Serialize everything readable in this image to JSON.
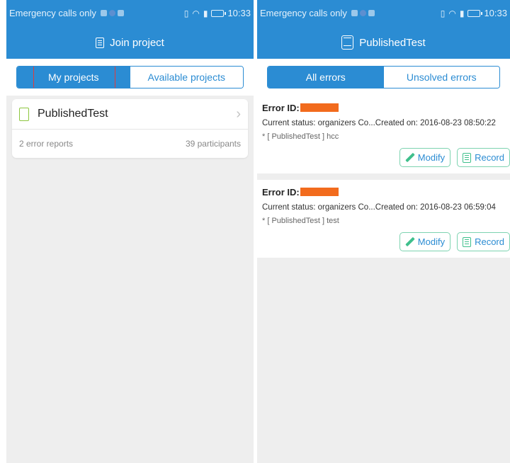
{
  "left_screen": {
    "status_bar": {
      "carrier_text": "Emergency calls only",
      "time": "10:33"
    },
    "title": "Join project",
    "tabs": [
      {
        "label": "My projects",
        "active": true
      },
      {
        "label": "Available projects",
        "active": false
      }
    ],
    "project": {
      "name": "PublishedTest",
      "error_reports": "2 error reports",
      "participants": "39 participants"
    }
  },
  "right_screen": {
    "status_bar": {
      "carrier_text": "Emergency calls only",
      "time": "10:33"
    },
    "title": "PublishedTest",
    "tabs": [
      {
        "label": "All errors",
        "active": true
      },
      {
        "label": "Unsolved errors",
        "active": false
      }
    ],
    "errors": [
      {
        "id_label": "Error ID:",
        "status": "Current status: organizers Co...Created on:  2016-08-23 08:50:22",
        "desc": "* [ PublishedTest ] hcc"
      },
      {
        "id_label": "Error ID:",
        "status": "Current status: organizers Co...Created on:  2016-08-23 06:59:04",
        "desc": "* [ PublishedTest ] test"
      }
    ],
    "actions": {
      "modify": "Modify",
      "record": "Record"
    }
  },
  "colors": {
    "primary": "#2b8cd3",
    "highlight": "#e13c3c",
    "redaction": "#f26b1d",
    "accent": "#3fbf8c"
  }
}
